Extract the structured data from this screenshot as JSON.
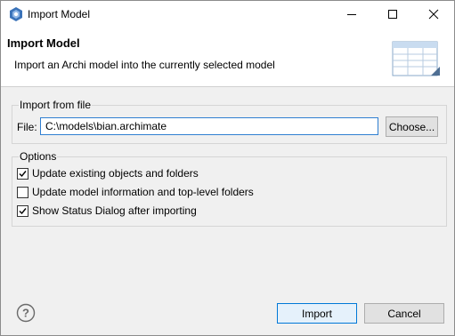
{
  "window": {
    "title": "Import Model"
  },
  "banner": {
    "title": "Import Model",
    "description": "Import an Archi model into the currently selected model"
  },
  "import_group": {
    "title": "Import from file",
    "file_label": "File:",
    "file_value": "C:\\models\\bian.archimate",
    "choose_label": "Choose..."
  },
  "options_group": {
    "title": "Options",
    "items": [
      {
        "label": "Update existing objects and folders",
        "checked": true
      },
      {
        "label": "Update model information and top-level folders",
        "checked": false
      },
      {
        "label": "Show Status Dialog after importing",
        "checked": true
      }
    ]
  },
  "footer": {
    "import_label": "Import",
    "cancel_label": "Cancel"
  },
  "icons": {
    "app": "archi-app-icon",
    "help": "help-icon",
    "banner": "table-image-icon"
  },
  "colors": {
    "accent": "#0078d7",
    "input_border": "#2f7fd1",
    "app_icon": "#3b73b9"
  }
}
